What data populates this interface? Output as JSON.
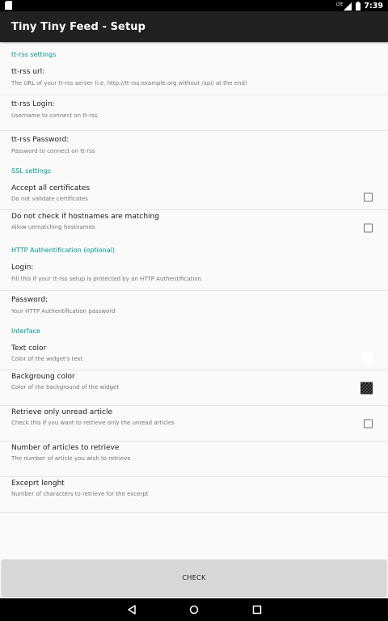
{
  "status_bar": {
    "time": "7:39",
    "lte_label": "LTE"
  },
  "toolbar": {
    "title": "Tiny Tiny Feed - Setup"
  },
  "categories": {
    "ttrss": "tt-rss settings",
    "ssl": "SSL settings",
    "http_auth": "HTTP Authentification (optional)",
    "interface": "Interface"
  },
  "prefs": {
    "url": {
      "title": "tt-rss url:",
      "summary": "The URL of your tt-rss server (i.e. http://tt-rss.example.org without /api/ at the end)"
    },
    "login": {
      "title": "tt-rss Login:",
      "summary": "Username to connect on tt-rss"
    },
    "password": {
      "title": "tt-rss Password:",
      "summary": "Password to connect on tt-rss"
    },
    "accept_certs": {
      "title": "Accept all certificates",
      "summary": "Do not validate certificates",
      "checked": false
    },
    "hostnames": {
      "title": "Do not check if hostnames are matching",
      "summary": "Allow unmatching hostnames",
      "checked": false
    },
    "http_login": {
      "title": "Login:",
      "summary": "Fill this if your tt-rss setup is protected by an HTTP Authentification"
    },
    "http_password": {
      "title": "Password:",
      "summary": "Your HTTP Authentification password"
    },
    "text_color": {
      "title": "Text color",
      "summary": "Color of the widget's text",
      "color": "#ffffff"
    },
    "bg_color": {
      "title": "Backgroung color",
      "summary": "Color of the background of the widget",
      "color": "transparent"
    },
    "unread_only": {
      "title": "Retrieve only unread article",
      "summary": "Check this if you want to retrieve only the unread articles",
      "checked": false
    },
    "num_articles": {
      "title": "Number of articles to retrieve",
      "summary": "The number of article you wish to retrieve"
    },
    "excerpt": {
      "title": "Exceprt lenght",
      "summary": "Number of characters to retrieve for the excerpt"
    }
  },
  "check_button": {
    "label": "CHECK"
  },
  "nav_bar": {
    "icons": [
      "back-icon",
      "home-icon",
      "recents-icon"
    ]
  },
  "colors": {
    "accent": "#009688",
    "toolbar": "#212121",
    "button": "#d6d7d7"
  }
}
